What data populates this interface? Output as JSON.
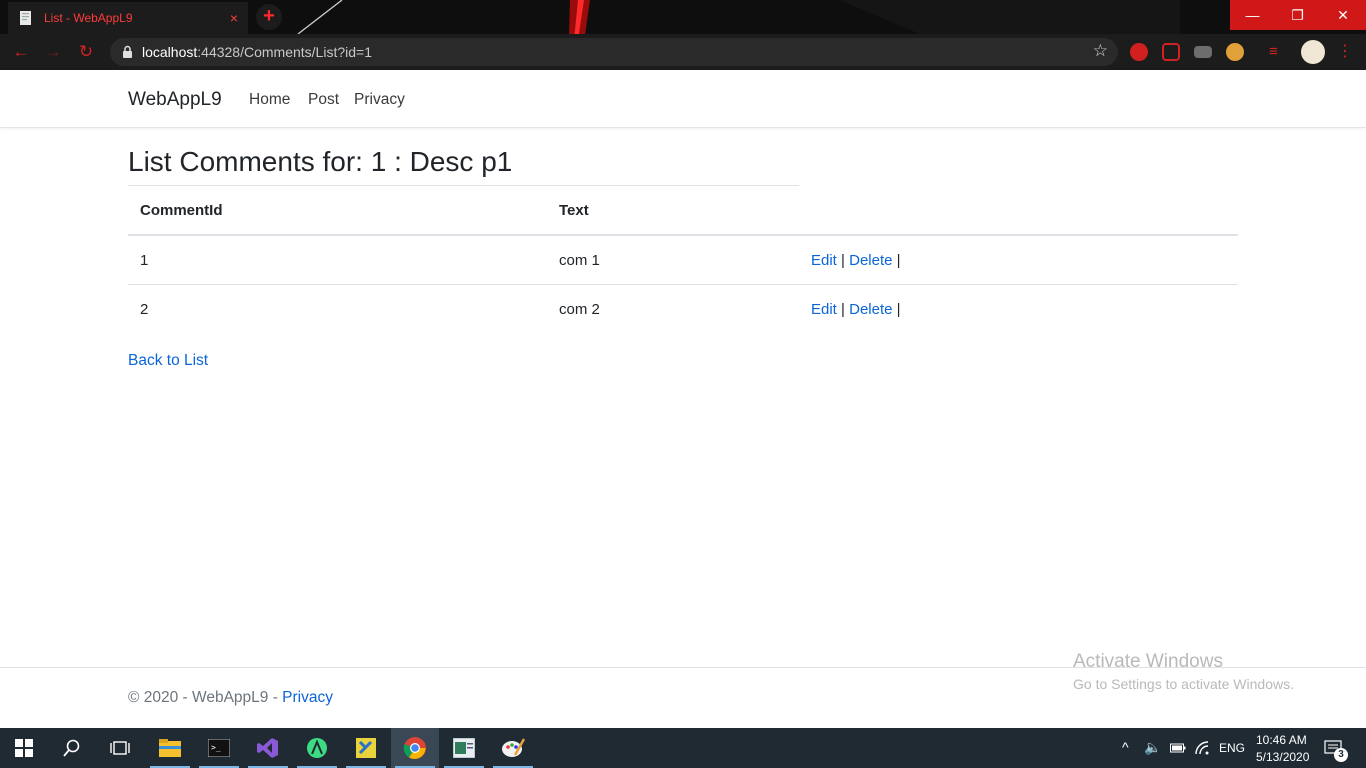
{
  "browser": {
    "tab_title": "List - WebAppL9",
    "tab_close": "×",
    "new_tab": "+",
    "url_host": "localhost",
    "url_rest": ":44328/Comments/List?id=1",
    "window_controls": {
      "minimize": "—",
      "restore": "❐",
      "close": "✕"
    },
    "accent_color": "#d42222"
  },
  "navbar": {
    "brand": "WebAppL9",
    "links": [
      {
        "label": "Home"
      },
      {
        "label": "Post"
      },
      {
        "label": "Privacy"
      }
    ]
  },
  "main": {
    "title": "List Comments for: 1 : Desc p1",
    "table": {
      "headers": [
        "CommentId",
        "Text"
      ],
      "rows": [
        {
          "id": "1",
          "text": "com 1",
          "edit": "Edit",
          "delete": "Delete",
          "sep": "|"
        },
        {
          "id": "2",
          "text": "com 2",
          "edit": "Edit",
          "delete": "Delete",
          "sep": "|"
        }
      ]
    },
    "back_link": "Back to List"
  },
  "footer": {
    "copyright": "© 2020 - WebAppL9 - ",
    "privacy": "Privacy"
  },
  "watermark": {
    "line1": "Activate Windows",
    "line2": "Go to Settings to activate Windows."
  },
  "taskbar": {
    "icons": [
      "windows-start-icon",
      "search-icon",
      "task-view-icon",
      "file-explorer-icon",
      "terminal-icon",
      "visual-studio-icon",
      "android-studio-icon",
      "sourcetree-icon",
      "chrome-icon",
      "notepad-icon",
      "paint-icon"
    ],
    "lang": "ENG",
    "time": "10:46 AM",
    "date": "5/13/2020",
    "notifications": "3"
  }
}
